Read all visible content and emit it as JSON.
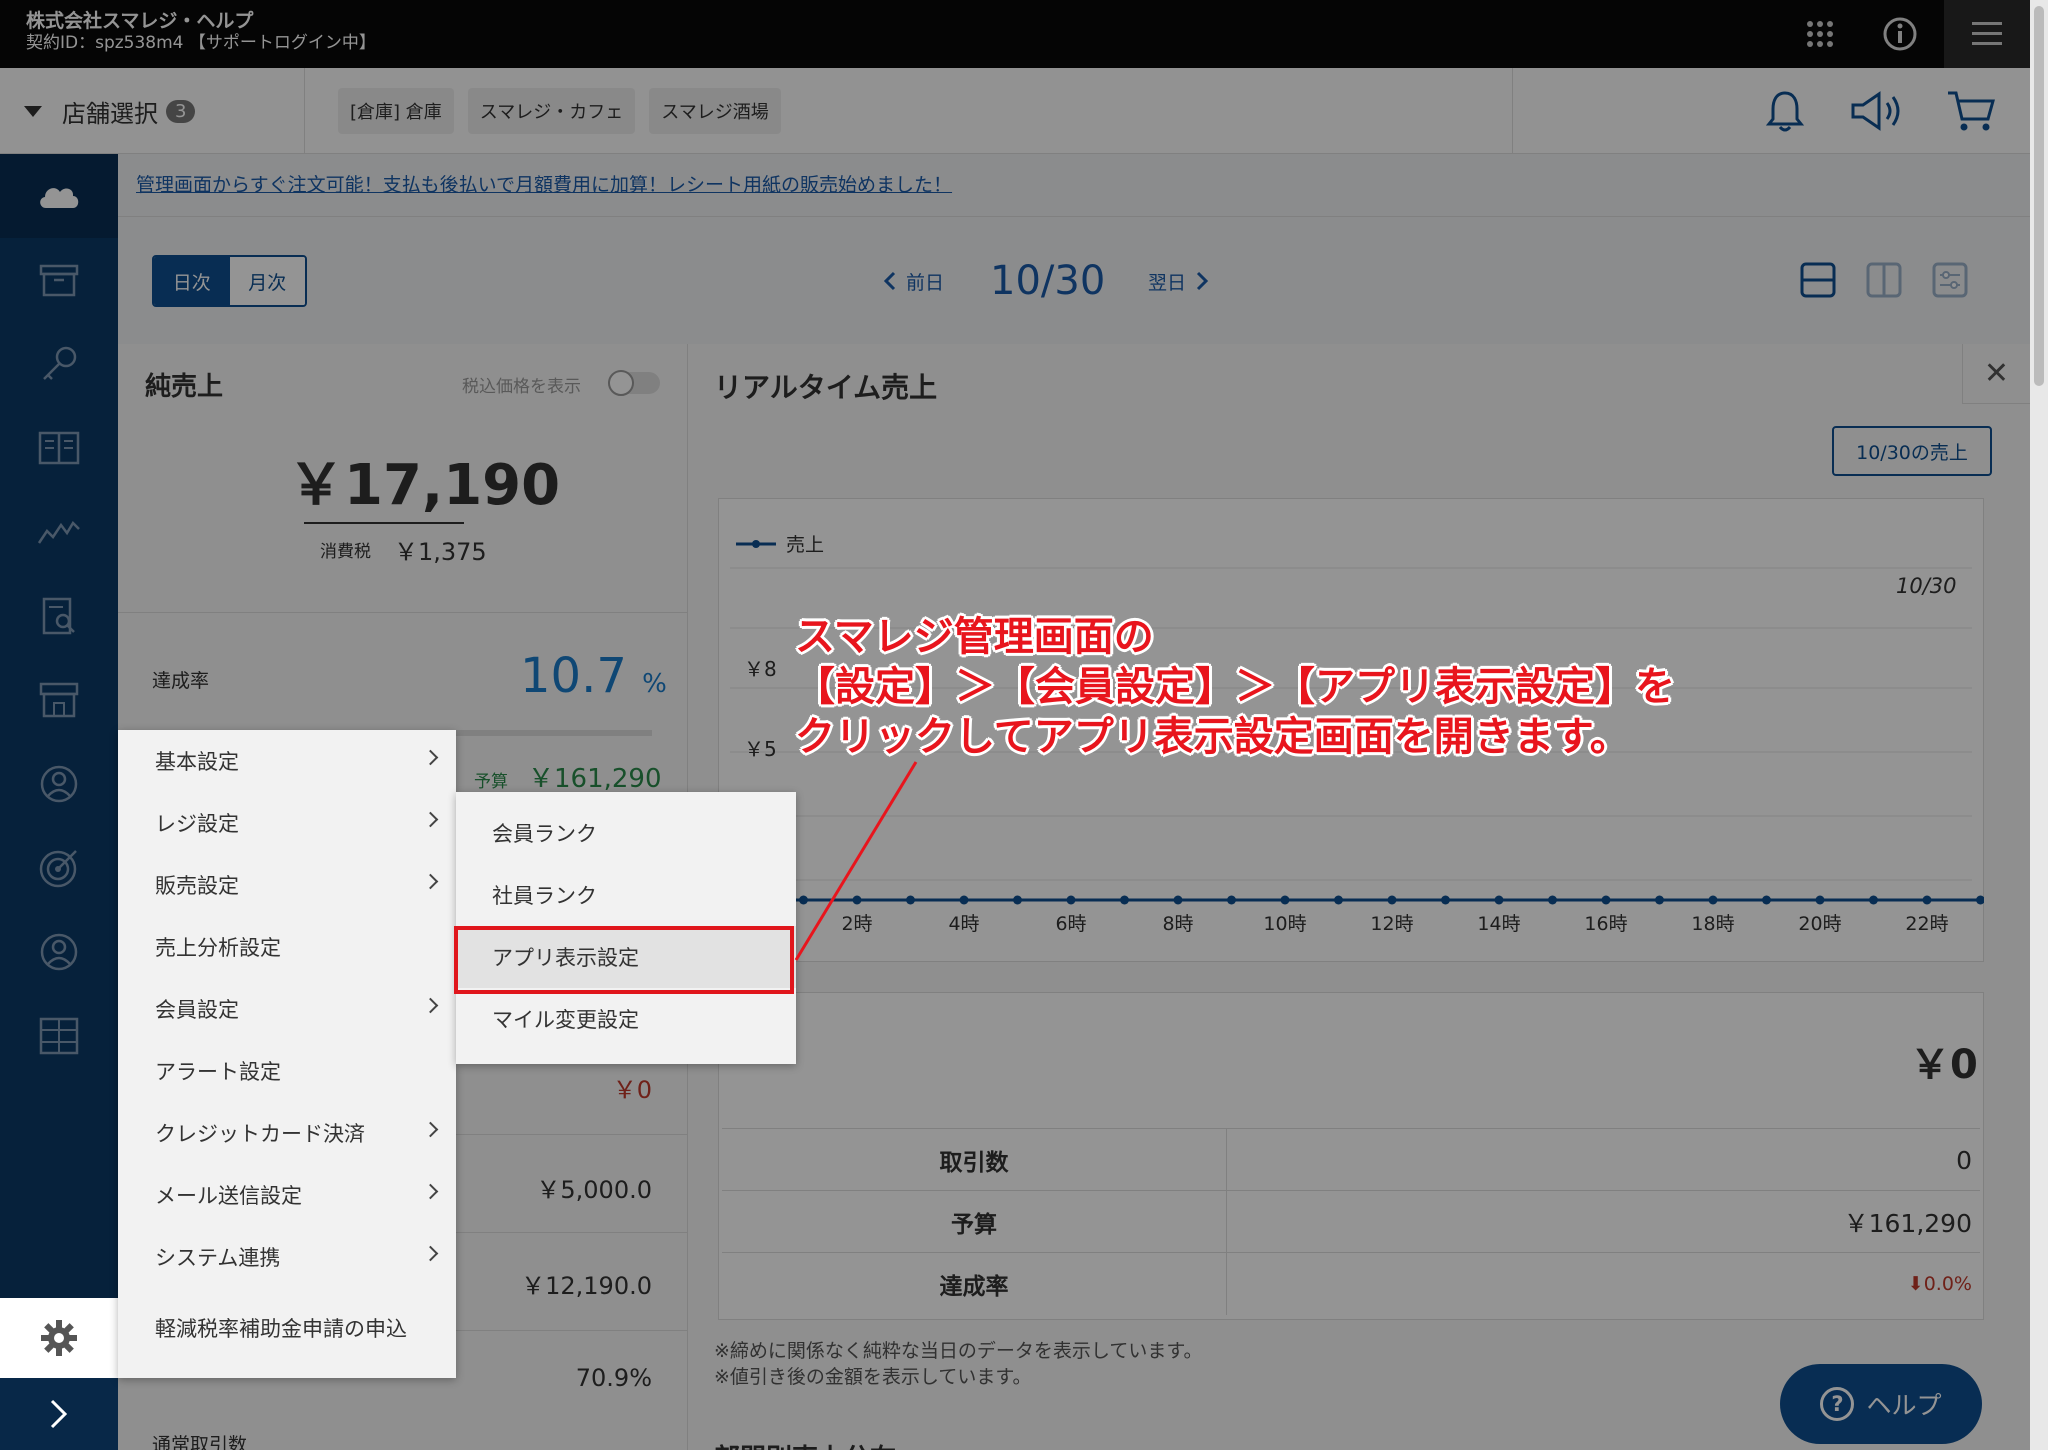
{
  "topbar": {
    "company": "株式会社スマレジ・ヘルプ",
    "contract": "契約ID：spz538m4 【サポートログイン中】"
  },
  "storebar": {
    "select_label": "店舗選択",
    "count": "3",
    "stores": [
      "[倉庫] 倉庫",
      "スマレジ・カフェ",
      "スマレジ酒場"
    ]
  },
  "banner": "管理画面からすぐ注文可能！支払も後払いで月額費用に加算！レシート用紙の販売始めました！",
  "period": {
    "daily": "日次",
    "monthly": "月次"
  },
  "datenav": {
    "prev": "前日",
    "date": "10/30",
    "next": "翌日"
  },
  "left_panel": {
    "title": "純売上",
    "tax_toggle_label": "税込価格を表示",
    "amount": "￥17,190",
    "consumption_tax_label": "消費税",
    "consumption_tax": "￥1,375",
    "achievement_label": "達成率",
    "achievement_value": "10.7",
    "achievement_unit": "%",
    "achievement_fraction": 0.107,
    "budget_label": "予算",
    "budget_value": "￥161,290",
    "partial_values": [
      "￥0",
      "￥5,000.0",
      "￥12,190.0",
      "70.9%"
    ],
    "normal_tx_label": "通常取引数"
  },
  "right_panel": {
    "title": "リアルタイム売上",
    "sales_button": "10/30の売上",
    "chart_date": "10/30",
    "total": "￥0",
    "rows": [
      {
        "label": "取引数",
        "value": "0"
      },
      {
        "label": "予算",
        "value": "￥161,290"
      },
      {
        "label": "達成率",
        "value": "0.0%"
      }
    ],
    "notes": [
      "※締めに関係なく純粋な当日のデータを表示しています。",
      "※値引き後の金額を表示しています。"
    ],
    "bottom_title": "部門別売上分布"
  },
  "chart_data": {
    "type": "line",
    "series": [
      {
        "name": "売上",
        "values": [
          0,
          0,
          0,
          0,
          0,
          0,
          0,
          0,
          0,
          0,
          0,
          0,
          0,
          0,
          0,
          0,
          0,
          0,
          0,
          0,
          0,
          0,
          0,
          0
        ]
      }
    ],
    "x": [
      0,
      1,
      2,
      3,
      4,
      5,
      6,
      7,
      8,
      9,
      10,
      11,
      12,
      13,
      14,
      15,
      16,
      17,
      18,
      19,
      20,
      21,
      22,
      23
    ],
    "x_tick_labels": [
      "2時",
      "4時",
      "6時",
      "8時",
      "10時",
      "12時",
      "14時",
      "16時",
      "18時",
      "20時",
      "22時"
    ],
    "y_tick_labels": [
      "￥8",
      "￥5"
    ],
    "color": "#0e4f8f"
  },
  "settings_menu": {
    "items": [
      {
        "label": "基本設定",
        "submenu": true
      },
      {
        "label": "レジ設定",
        "submenu": true
      },
      {
        "label": "販売設定",
        "submenu": true
      },
      {
        "label": "売上分析設定",
        "submenu": false
      },
      {
        "label": "会員設定",
        "submenu": true
      },
      {
        "label": "アラート設定",
        "submenu": false
      },
      {
        "label": "クレジットカード決済",
        "submenu": true
      },
      {
        "label": "メール送信設定",
        "submenu": true
      },
      {
        "label": "システム連携",
        "submenu": true
      },
      {
        "label": "軽減税率補助金申請の申込",
        "submenu": false
      }
    ]
  },
  "member_submenu": {
    "items": [
      "会員ランク",
      "社員ランク",
      "アプリ表示設定",
      "マイル変更設定"
    ],
    "highlighted": "アプリ表示設定"
  },
  "callout": {
    "lines": [
      "スマレジ管理画面の",
      "【設定】＞【会員設定】＞【アプリ表示設定】を",
      "クリックしてアプリ表示設定画面を開きます。"
    ],
    "color": "#e8151d"
  },
  "help_button": "ヘルプ"
}
